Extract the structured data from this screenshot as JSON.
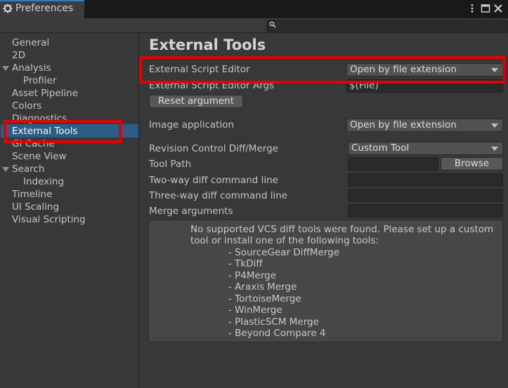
{
  "window": {
    "title": "Preferences",
    "tab_icon": "gear-icon",
    "controls": [
      "kebab-menu-icon",
      "maximize-icon",
      "close-icon"
    ]
  },
  "search": {
    "placeholder": "",
    "icon": "search-icon"
  },
  "sidebar": {
    "items": [
      {
        "label": "General"
      },
      {
        "label": "2D"
      },
      {
        "label": "Analysis"
      },
      {
        "label": "Profiler"
      },
      {
        "label": "Asset Pipeline"
      },
      {
        "label": "Colors"
      },
      {
        "label": "Diagnostics"
      },
      {
        "label": "External Tools",
        "selected": true
      },
      {
        "label": "GI Cache"
      },
      {
        "label": "Scene View"
      },
      {
        "label": "Search"
      },
      {
        "label": "Indexing"
      },
      {
        "label": "Timeline"
      },
      {
        "label": "UI Scaling"
      },
      {
        "label": "Visual Scripting"
      }
    ]
  },
  "main": {
    "title": "External Tools",
    "external_script_editor": {
      "label": "External Script Editor",
      "value": "Open by file extension"
    },
    "external_script_editor_args": {
      "label": "External Script Editor Args",
      "value": "$(File)"
    },
    "reset_argument_button": "Reset argument",
    "image_application": {
      "label": "Image application",
      "value": "Open by file extension"
    },
    "revision_control": {
      "label": "Revision Control Diff/Merge",
      "value": "Custom Tool"
    },
    "tool_path": {
      "label": "Tool Path",
      "value": ""
    },
    "browse_button": "Browse",
    "two_way": {
      "label": "Two-way diff command line",
      "value": ""
    },
    "three_way": {
      "label": "Three-way diff command line",
      "value": ""
    },
    "merge_args": {
      "label": "Merge arguments",
      "value": ""
    },
    "help": {
      "line1": "No supported VCS diff tools were found. Please set up a custom",
      "line2": "tool or install one of the following tools:",
      "tools": [
        "- SourceGear DiffMerge",
        "- TkDiff",
        "- P4Merge",
        "- Araxis Merge",
        "- TortoiseMerge",
        "- WinMerge",
        "- PlasticSCM Merge",
        "- Beyond Compare 4"
      ]
    }
  },
  "highlight_color": "#e00000",
  "selection_color": "#2c5d87"
}
